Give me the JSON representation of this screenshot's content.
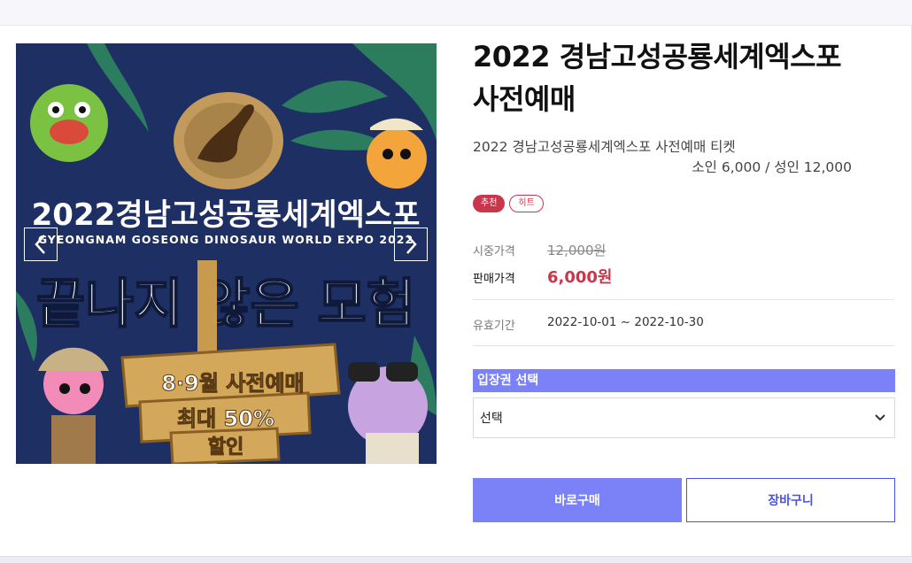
{
  "product": {
    "title": "2022 경남고성공룡세계엑스포\n사전예매",
    "subtitle_line1": "2022 경남고성공룡세계엑스포 사전예매 티켓",
    "subtitle_line2": "소인 6,000 / 성인 12,000",
    "badges": [
      "추천",
      "히트"
    ],
    "consumer_price_label": "시중가격",
    "consumer_price": "12,000원",
    "sale_price_label": "판매가격",
    "sale_price": "6,000원",
    "valid_label": "유효기간",
    "valid_period": "2022-10-01 ~ 2022-10-30"
  },
  "ticket": {
    "header": "입장권 선택",
    "selected": "선택"
  },
  "actions": {
    "buy_now": "바로구매",
    "cart": "장바구니"
  },
  "banner": {
    "headline": "2022경남고성공룡세계엑스포",
    "english": "GYEONGNAM GOSEONG DINOSAUR WORLD EXPO 2022",
    "slogan": "끝나지 않은 모험",
    "sign_line1": "8·9월 사전예매",
    "sign_line2": "최대 50%",
    "sign_line3": "할인"
  },
  "colors": {
    "accent": "#7b82f7",
    "price_red": "#c8374c",
    "banner_bg": "#1d2f63"
  },
  "icons": {
    "prev": "chevron-left-icon",
    "next": "chevron-right-icon",
    "dropdown": "chevron-down-icon"
  }
}
